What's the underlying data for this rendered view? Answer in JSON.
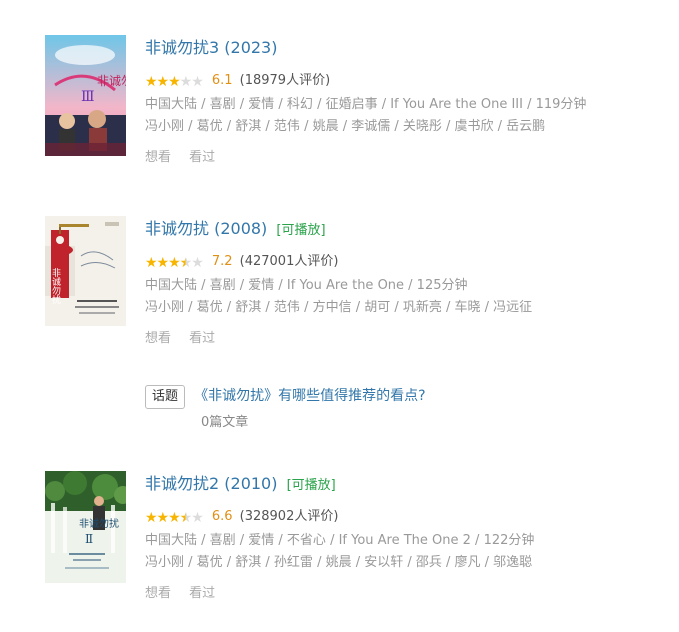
{
  "movies": [
    {
      "title": "非诚勿扰3 (2023)",
      "playable": "",
      "rating_score": "6.1",
      "stars": 3,
      "rating_count": "(18979人评价)",
      "meta_line1": "中国大陆 / 喜剧 / 爱情 / 科幻 / 征婚启事 / If You Are the One III / 119分钟",
      "meta_line2": "冯小刚 / 葛优 / 舒淇 / 范伟 / 姚晨 / 李诚儒 / 关晓彤 / 虞书欣 / 岳云鹏",
      "want_label": "想看",
      "seen_label": "看过",
      "poster_text": "非诚勿扰",
      "poster_number": "Ⅲ"
    },
    {
      "title": "非诚勿扰 (2008)",
      "playable": "[可播放]",
      "rating_score": "7.2",
      "stars": 3.5,
      "rating_count": "(427001人评价)",
      "meta_line1": "中国大陆 / 喜剧 / 爱情 / If You Are the One / 125分钟",
      "meta_line2": "冯小刚 / 葛优 / 舒淇 / 范伟 / 方中信 / 胡可 / 巩新亮 / 车晓 / 冯远征",
      "want_label": "想看",
      "seen_label": "看过",
      "poster_text": "非诚勿扰",
      "poster_number": ""
    },
    {
      "title": "非诚勿扰2 (2010)",
      "playable": "[可播放]",
      "rating_score": "6.6",
      "stars": 3.5,
      "rating_count": "(328902人评价)",
      "meta_line1": "中国大陆 / 喜剧 / 爱情 / 不省心 / If You Are The One 2 / 122分钟",
      "meta_line2": "冯小刚 / 葛优 / 舒淇 / 孙红雷 / 姚晨 / 安以轩 / 邵兵 / 廖凡 / 邬逸聪",
      "want_label": "想看",
      "seen_label": "看过",
      "poster_text": "非诚勿扰",
      "poster_number": "Ⅱ"
    }
  ],
  "topic": {
    "badge": "话题",
    "title": "《非诚勿扰》有哪些值得推荐的看点?",
    "article_count": "0篇文章"
  }
}
